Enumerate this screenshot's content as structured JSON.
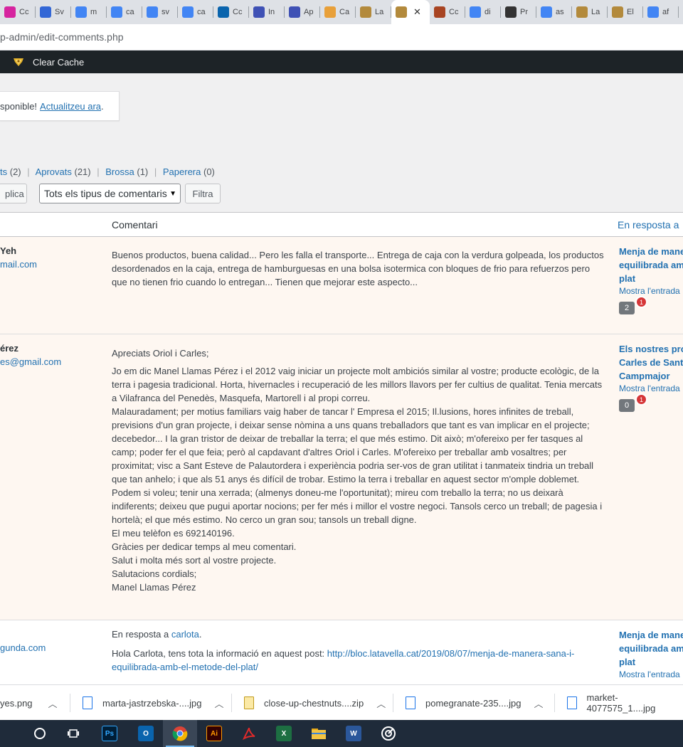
{
  "browser": {
    "tabs": [
      {
        "label": "Cc",
        "icon": "instagram-icon",
        "color": "#d6249f"
      },
      {
        "label": "Sv",
        "icon": "shield-icon",
        "color": "#3367d6"
      },
      {
        "label": "m",
        "icon": "google-icon",
        "color": "#4285f4"
      },
      {
        "label": "ca",
        "icon": "google-icon",
        "color": "#4285f4"
      },
      {
        "label": "sv",
        "icon": "google-icon",
        "color": "#4285f4"
      },
      {
        "label": "ca",
        "icon": "google-icon",
        "color": "#4285f4"
      },
      {
        "label": "Cc",
        "icon": "outlook-icon",
        "color": "#0a64ad"
      },
      {
        "label": "In",
        "icon": "circle-c-icon",
        "color": "#3f51b5"
      },
      {
        "label": "Ap",
        "icon": "circle-c-icon",
        "color": "#3f51b5"
      },
      {
        "label": "Ca",
        "icon": "hexagon-icon",
        "color": "#e8a03a"
      },
      {
        "label": "La",
        "icon": "basket-icon",
        "color": "#b38a3c"
      },
      {
        "label": "",
        "icon": "basket-icon",
        "color": "#b38a3c",
        "active": true
      },
      {
        "label": "Cc",
        "icon": "leaf-icon",
        "color": "#a84422"
      },
      {
        "label": "di",
        "icon": "google-icon",
        "color": "#4285f4"
      },
      {
        "label": "Pr",
        "icon": "wikipedia-icon",
        "color": "#333333"
      },
      {
        "label": "as",
        "icon": "google-icon",
        "color": "#4285f4"
      },
      {
        "label": "La",
        "icon": "basket-icon",
        "color": "#b38a3c"
      },
      {
        "label": "El",
        "icon": "basket-icon",
        "color": "#b38a3c"
      },
      {
        "label": "af",
        "icon": "google-icon",
        "color": "#4285f4"
      }
    ],
    "url": "p-admin/edit-comments.php"
  },
  "adminbar": {
    "clear_cache": "Clear Cache"
  },
  "notice": {
    "text": "sponible!",
    "link": "Actualitzeu ara",
    "end": "."
  },
  "filters": {
    "pending_tail": "ts",
    "pending_count": "(2)",
    "approved": "Aprovats",
    "approved_count": "(21)",
    "spam": "Brossa",
    "spam_count": "(1)",
    "trash": "Paperera",
    "trash_count": "(0)",
    "sep": "|"
  },
  "tablenav": {
    "apply": "plica",
    "type_select": "Tots els tipus de comentaris",
    "filter": "Filtra"
  },
  "table": {
    "col_comment": "Comentari",
    "col_response": "En resposta a"
  },
  "comments": [
    {
      "author": "Yeh",
      "email": "mail.com",
      "paragraphs": [
        "Buenos productos, buena calidad... Pero les falla el transporte... Entrega de caja con la verdura golpeada, los productos desordenados en la caja, entrega de hamburguesas en una bolsa isotermica con bloques de frio para refuerzos pero que no tienen frio cuando lo entregan... Tienen que mejorar este aspecto..."
      ],
      "post_title": "Menja de manera sana i equilibrada amb el mètode del plat",
      "view_post": "Mostra l'entrada",
      "approved": "2",
      "pending": "1"
    },
    {
      "author": "érez",
      "email": "es@gmail.com",
      "paragraphs": [
        "Apreciats Oriol i Carles;",
        "Jo em dic Manel Llamas Pérez i el 2012 vaig iniciar un projecte molt ambiciós similar al vostre; producte ecològic, de la terra i pagesia tradicional. Horta, hivernacles i recuperació de les millors llavors per fer cultius de qualitat. Tenia mercats a Vilafranca del Penedès, Masquefa, Martorell i al propi correu.",
        "Malauradament; per motius familiars vaig haber de tancar l' Empresa el 2015; Il.lusions, hores infinites de treball, previsions d'un gran projecte, i deixar sense nòmina a uns quans treballadors que tant es van implicar en el projecte; decebedor... I la gran tristor de deixar de treballar la terra; el que més estimo. Dit això; m'ofereixo per fer tasques al camp; poder fer el que feia; però al capdavant d'altres Oriol i Carles. M'ofereixo per treballar amb vosaltres; per proximitat; visc a Sant Esteve de Palautordera i experiència podria ser-vos de gran utilitat i tanmateix tindria un treball que tan anhelo; i que als 51 anys és difícil de trobar. Estimo la terra i treballar en aquest sector m'omple doblemet. Podem si voleu; tenir una xerrada; (almenys doneu-me l'oportunitat); mireu com treballo la terra; no us deixarà indiferents; deixeu que pugui aportar nocions; per fer més i millor el vostre negoci. Tansols cerco un treball; de pagesia i hortelà; el que més estimo. No cerco un gran sou; tansols un treball digne.",
        "El meu telèfon es 692140196.",
        "Gràcies per dedicar temps al meu comentari.",
        "Salut i molta més sort al vostre projecte.",
        "Salutacions cordials;",
        "Manel Llamas Pérez"
      ],
      "post_title": "Els nostres productors: Oriol i Carles de Sant Pere de Campmajor",
      "view_post": "Mostra l'entrada",
      "approved": "0",
      "pending": "1"
    },
    {
      "author": "",
      "email": "gunda.com",
      "reply_prefix": "En resposta a",
      "reply_to": "carlota",
      "reply_suffix": ".",
      "text_before_link": "Hola Carlota, tens tota la informació en aquest post: ",
      "link": "http://bloc.latavella.cat/2019/08/07/menja-de-manera-sana-i-equilibrada-amb-el-metode-del-plat/",
      "post_title": "Menja de manera sana i equilibrada amb el mètode del plat",
      "view_post": "Mostra l'entrada"
    }
  ],
  "downloads": [
    {
      "name": "yes.png",
      "icon": "image-file-icon"
    },
    {
      "name": "marta-jastrzebska-....jpg",
      "icon": "image-file-icon"
    },
    {
      "name": "close-up-chestnuts....zip",
      "icon": "zip-file-icon"
    },
    {
      "name": "pomegranate-235....jpg",
      "icon": "image-file-icon"
    },
    {
      "name": "market-4077575_1....jpg",
      "icon": "image-file-icon"
    }
  ],
  "taskbar": [
    {
      "name": "cortana-icon",
      "label": "",
      "color": ""
    },
    {
      "name": "task-view-icon",
      "label": "",
      "color": ""
    },
    {
      "name": "photoshop-icon",
      "label": "Ps",
      "color": "#001e36"
    },
    {
      "name": "outlook-icon",
      "label": "O",
      "color": "#0a64ad"
    },
    {
      "name": "chrome-icon",
      "label": "",
      "color": "",
      "active": true
    },
    {
      "name": "illustrator-icon",
      "label": "Ai",
      "color": "#330000"
    },
    {
      "name": "acrobat-icon",
      "label": "",
      "color": "#d4161c"
    },
    {
      "name": "excel-icon",
      "label": "X",
      "color": "#1d6f42"
    },
    {
      "name": "file-explorer-icon",
      "label": "",
      "color": "#f4c542"
    },
    {
      "name": "word-icon",
      "label": "W",
      "color": "#2b579a"
    },
    {
      "name": "settings-ring-icon",
      "label": "",
      "color": ""
    }
  ]
}
